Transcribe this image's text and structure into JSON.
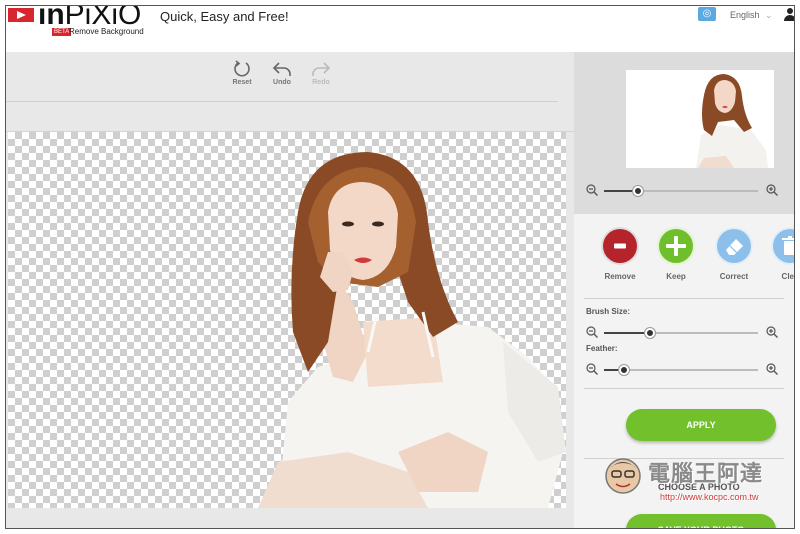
{
  "header": {
    "brand": {
      "in": "in",
      "pixio": "PiXiO",
      "badge": "BETA",
      "subtitle": "Remove Background"
    },
    "tagline": "Quick, Easy and Free!",
    "language": "English",
    "language_chevron": "⌄"
  },
  "toolbar": {
    "reset_label": "Reset",
    "undo_label": "Undo",
    "redo_label": "Redo"
  },
  "preview": {
    "zoom_level": 0.22
  },
  "tools": {
    "remove_label": "Remove",
    "keep_label": "Keep",
    "correct_label": "Correct",
    "clear_label": "Clea"
  },
  "sliders": {
    "brush_label": "Brush Size:",
    "brush_value": 0.3,
    "feather_label": "Feather:",
    "feather_value": 0.13
  },
  "actions": {
    "apply_label": "APPLY",
    "choose_label": "CHOOSE A PHOTO",
    "save_label": "SAVE YOUR PHOTO"
  },
  "watermark": {
    "text": "電腦王阿達",
    "url": "http://www.kocpc.com.tw"
  },
  "colors": {
    "remove": "#b5232b",
    "keep": "#6fbe2c",
    "correct": "#8cc0ea",
    "clear": "#8cc0ea",
    "accent": "#72c02c"
  },
  "icons": {
    "reset": "reset-icon",
    "undo": "undo-icon",
    "redo": "redo-icon",
    "zoom_out": "zoom-out-icon",
    "zoom_in": "zoom-in-icon",
    "eraser": "eraser-icon",
    "trash": "trash-icon",
    "globe": "globe-icon",
    "user": "user-icon"
  }
}
